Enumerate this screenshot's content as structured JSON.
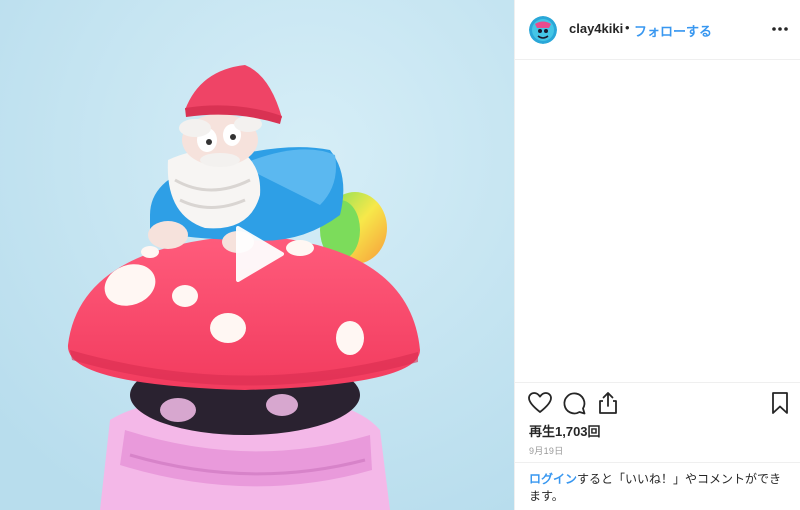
{
  "header": {
    "username": "clay4kiki",
    "separator": "•",
    "follow_label": "フォローする",
    "more_icon": "more-horizontal-icon"
  },
  "media": {
    "type": "video",
    "play_icon": "play-icon"
  },
  "actions": {
    "like_icon": "heart-icon",
    "comment_icon": "comment-bubble-icon",
    "share_icon": "share-icon",
    "save_icon": "bookmark-icon"
  },
  "stats": {
    "views_label": "再生1,703回",
    "date": "9月19日"
  },
  "comment_prompt": {
    "login_link": "ログイン",
    "text": "すると「いいね！」やコメントができます。"
  },
  "colors": {
    "link_blue": "#3897f0",
    "border": "#efefef",
    "text": "#262626",
    "muted": "#999999",
    "media_background": "#c7e5f1"
  }
}
